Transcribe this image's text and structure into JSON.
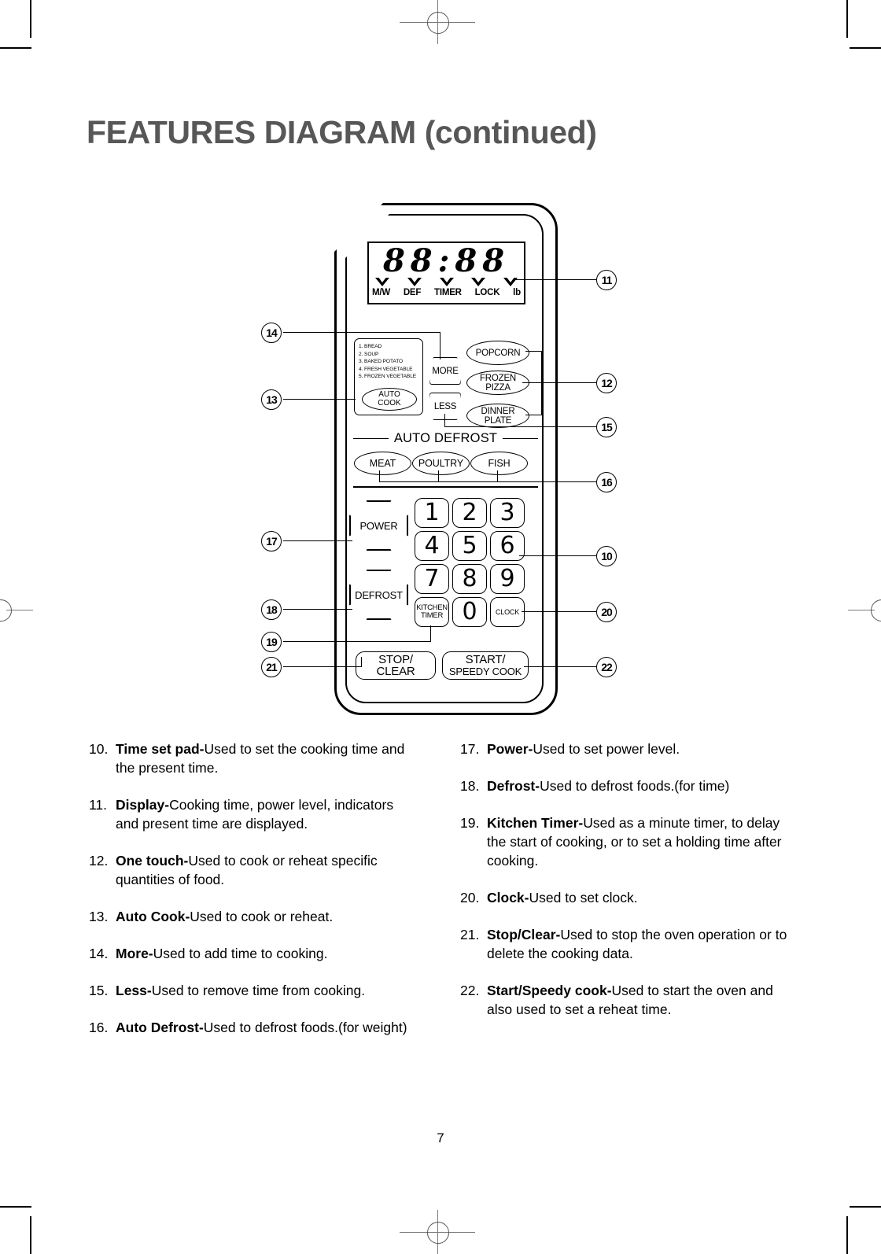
{
  "page": {
    "title": "FEATURES DIAGRAM (continued)",
    "number": "7"
  },
  "diagram": {
    "display": {
      "digits": "88:88",
      "indicator_labels": [
        "M/W",
        "DEF",
        "TIMER",
        "LOCK",
        "lb"
      ]
    },
    "auto_cook": {
      "menu": [
        "1. BREAD",
        "2. SOUP",
        "3. BAKED POTATO",
        "4. FRESH VEGETABLE",
        "5. FROZEN VEGETABLE"
      ],
      "button_line1": "AUTO",
      "button_line2": "COOK"
    },
    "adjust": {
      "more": "MORE",
      "less": "LESS"
    },
    "one_touch": [
      {
        "line1": "POPCORN",
        "line2": ""
      },
      {
        "line1": "FROZEN",
        "line2": "PIZZA"
      },
      {
        "line1": "DINNER",
        "line2": "PLATE"
      }
    ],
    "auto_defrost": {
      "heading": "AUTO DEFROST",
      "buttons": [
        "MEAT",
        "POULTRY",
        "FISH"
      ]
    },
    "power_button": "POWER",
    "defrost_button": "DEFROST",
    "keypad": [
      "1",
      "2",
      "3",
      "4",
      "5",
      "6",
      "7",
      "8",
      "9",
      "0"
    ],
    "kitchen_timer": {
      "line1": "KITCHEN",
      "line2": "TIMER"
    },
    "clock": "CLOCK",
    "stop_clear": {
      "line1": "STOP/",
      "line2": "CLEAR"
    },
    "start_speedy": {
      "line1": "START/",
      "line2": "SPEEDY COOK"
    },
    "callouts_left": [
      "14",
      "13",
      "17",
      "18",
      "19",
      "21"
    ],
    "callouts_right": [
      "11",
      "12",
      "15",
      "16",
      "10",
      "20",
      "22"
    ]
  },
  "descriptions": {
    "left": [
      {
        "n": "10.",
        "bold": "Time set pad-",
        "rest": "Used to set the cooking time and the present time."
      },
      {
        "n": "11.",
        "bold": "Display-",
        "rest": "Cooking time, power level, indicators and present time are displayed."
      },
      {
        "n": "12.",
        "bold": "One touch-",
        "rest": "Used to cook or reheat specific quantities of food."
      },
      {
        "n": "13.",
        "bold": "Auto Cook-",
        "rest": "Used to cook or reheat."
      },
      {
        "n": "14.",
        "bold": "More-",
        "rest": "Used to add time to cooking."
      },
      {
        "n": "15.",
        "bold": "Less-",
        "rest": "Used to remove time from cooking."
      },
      {
        "n": "16.",
        "bold": "Auto Defrost-",
        "rest": "Used to defrost foods.(for weight)"
      }
    ],
    "right": [
      {
        "n": "17.",
        "bold": "Power-",
        "rest": "Used to set power level."
      },
      {
        "n": "18.",
        "bold": "Defrost-",
        "rest": "Used to defrost foods.(for time)"
      },
      {
        "n": "19.",
        "bold": "Kitchen Timer-",
        "rest": "Used as a minute timer, to delay the start of cooking, or to set a holding time after cooking."
      },
      {
        "n": "20.",
        "bold": "Clock-",
        "rest": "Used to set clock."
      },
      {
        "n": "21.",
        "bold": "Stop/Clear-",
        "rest": "Used to stop the oven operation or to delete the cooking data."
      },
      {
        "n": "22.",
        "bold": "Start/Speedy cook-",
        "rest": "Used to start the oven and also used to set a reheat time."
      }
    ]
  },
  "colors": {
    "title": "#575757",
    "ink": "#000000",
    "regmark": "#7a7a7a"
  }
}
